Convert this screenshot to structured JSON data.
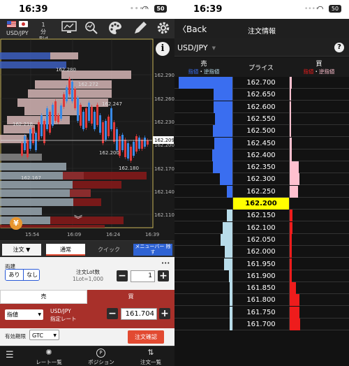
{
  "status": {
    "time": "16:39",
    "battery": "50"
  },
  "left": {
    "pair_label": "USD/JPY",
    "timeframe": "1分 Bid",
    "chart": {
      "current_price": "162.209",
      "y_ticks": [
        "162.290",
        "162.260",
        "162.230",
        "162.200",
        "162.170",
        "162.140",
        "162.110"
      ],
      "x_ticks": [
        "15:54",
        "16:09",
        "16:24",
        "16:39"
      ],
      "annotations": [
        "162.280",
        "162.272",
        "162.247",
        "162.218",
        "162.200",
        "162.180",
        "162.167"
      ]
    },
    "yen_icon": "¥",
    "tabs": {
      "order": "注文 ▼",
      "normal": "通常",
      "quick": "クイック",
      "member": "メニューバー 除す"
    },
    "ryodate": "両建",
    "toggle": {
      "on": "あり",
      "off": "なし"
    },
    "lot": {
      "label": "注文Lot数",
      "unit": "1Lot=1,000",
      "value": "1"
    },
    "sides": {
      "sell": "売",
      "buy": "買"
    },
    "order_type": "指値",
    "pair_rate_label_1": "USD/JPY",
    "pair_rate_label_2": "指定レート",
    "price_value": "161.704",
    "expiry_label": "有効期限",
    "expiry_value": "GTC",
    "confirm": "注文確認",
    "more": "•••",
    "nav": {
      "rates": "レート一覧",
      "positions": "ポジション",
      "orders": "注文一覧"
    }
  },
  "right": {
    "back": "Back",
    "title": "注文情報",
    "pair": "USD/JPY",
    "help": "?",
    "header": {
      "sell": "売",
      "sell_sub_1": "指値",
      "sell_sub_dot": "・",
      "sell_sub_2": "逆指値",
      "price": "プライス",
      "buy": "買",
      "buy_sub_1": "指値",
      "buy_sub_dot": "・",
      "buy_sub_2": "逆指値"
    },
    "current": "162.200",
    "colors": {
      "sell_blue": "#3a6ef0",
      "sell_light": "#b8dcea",
      "buy_red": "#ee1c1c",
      "buy_pink": "#ffc0cf",
      "current_bg": "#ffff00"
    },
    "rows": [
      {
        "price": "162.700",
        "sell": 0.92,
        "sell_type": "blue",
        "buy": 0.04,
        "buy_type": "pink"
      },
      {
        "price": "162.650",
        "sell": 0.32,
        "sell_type": "blue",
        "buy": 0.02,
        "buy_type": "pink"
      },
      {
        "price": "162.600",
        "sell": 0.32,
        "sell_type": "blue",
        "buy": 0.02,
        "buy_type": "pink"
      },
      {
        "price": "162.550",
        "sell": 0.3,
        "sell_type": "blue",
        "buy": 0.02,
        "buy_type": "pink"
      },
      {
        "price": "162.500",
        "sell": 0.33,
        "sell_type": "blue",
        "buy": 0.02,
        "buy_type": "pink"
      },
      {
        "price": "162.450",
        "sell": 0.31,
        "sell_type": "blue",
        "buy": 0.03,
        "buy_type": "pink"
      },
      {
        "price": "162.400",
        "sell": 0.34,
        "sell_type": "blue",
        "buy": 0.03,
        "buy_type": "pink"
      },
      {
        "price": "162.350",
        "sell": 0.33,
        "sell_type": "blue",
        "buy": 0.15,
        "buy_type": "pink"
      },
      {
        "price": "162.300",
        "sell": 0.22,
        "sell_type": "blue",
        "buy": 0.16,
        "buy_type": "pink"
      },
      {
        "price": "162.250",
        "sell": 0.1,
        "sell_type": "blue",
        "buy": 0.14,
        "buy_type": "pink"
      },
      {
        "price": "162.150",
        "sell": 0.1,
        "sell_type": "light",
        "buy": 0.05,
        "buy_type": "red"
      },
      {
        "price": "162.100",
        "sell": 0.17,
        "sell_type": "light",
        "buy": 0.05,
        "buy_type": "red"
      },
      {
        "price": "162.050",
        "sell": 0.2,
        "sell_type": "light",
        "buy": 0.04,
        "buy_type": "red"
      },
      {
        "price": "162.000",
        "sell": 0.13,
        "sell_type": "light",
        "buy": 0.04,
        "buy_type": "red"
      },
      {
        "price": "161.950",
        "sell": 0.14,
        "sell_type": "light",
        "buy": 0.03,
        "buy_type": "red"
      },
      {
        "price": "161.900",
        "sell": 0.06,
        "sell_type": "light",
        "buy": 0.03,
        "buy_type": "red"
      },
      {
        "price": "161.850",
        "sell": 0.05,
        "sell_type": "light",
        "buy": 0.1,
        "buy_type": "red"
      },
      {
        "price": "161.800",
        "sell": 0.05,
        "sell_type": "light",
        "buy": 0.16,
        "buy_type": "red"
      },
      {
        "price": "161.750",
        "sell": 0.05,
        "sell_type": "light",
        "buy": 0.16,
        "buy_type": "red"
      },
      {
        "price": "161.700",
        "sell": 0.05,
        "sell_type": "light",
        "buy": 0.18,
        "buy_type": "red"
      }
    ]
  }
}
